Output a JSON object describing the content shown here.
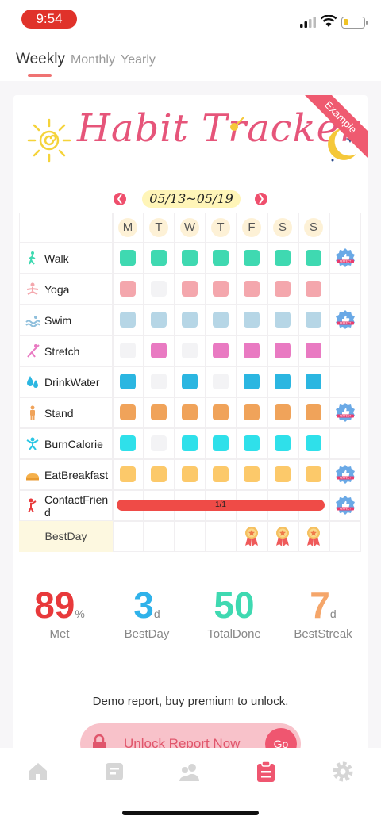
{
  "status_bar": {
    "time": "9:54"
  },
  "tabs": [
    {
      "label": "Weekly",
      "active": true
    },
    {
      "label": "Monthly",
      "active": false
    },
    {
      "label": "Yearly",
      "active": false
    }
  ],
  "card": {
    "title": "Habit Tracker",
    "ribbon": "Example",
    "week_range": "05/13~05/19",
    "days": [
      "M",
      "T",
      "W",
      "T",
      "F",
      "S",
      "S"
    ],
    "habits": [
      {
        "name": "Walk",
        "icon": "walk-icon",
        "color": "#3fd9b1",
        "done": [
          1,
          1,
          1,
          1,
          1,
          1,
          1
        ],
        "perfect": true
      },
      {
        "name": "Yoga",
        "icon": "yoga-icon",
        "color": "#f4a7ad",
        "done": [
          1,
          0,
          1,
          1,
          1,
          1,
          1
        ],
        "perfect": false
      },
      {
        "name": "Swim",
        "icon": "swim-icon",
        "color": "#b6d6e6",
        "done": [
          1,
          1,
          1,
          1,
          1,
          1,
          1
        ],
        "perfect": true
      },
      {
        "name": "Stretch",
        "icon": "stretch-icon",
        "color": "#e97ac2",
        "done": [
          0,
          1,
          0,
          1,
          1,
          1,
          1
        ],
        "perfect": false
      },
      {
        "name": "DrinkWater",
        "icon": "water-drop-icon",
        "color": "#2bb6e1",
        "done": [
          1,
          0,
          1,
          0,
          1,
          1,
          1
        ],
        "perfect": false
      },
      {
        "name": "Stand",
        "icon": "stand-icon",
        "color": "#f0a35a",
        "done": [
          1,
          1,
          1,
          1,
          1,
          1,
          1
        ],
        "perfect": true
      },
      {
        "name": "BurnCalorie",
        "icon": "burn-calorie-icon",
        "color": "#2fe0ea",
        "done": [
          1,
          0,
          1,
          1,
          1,
          1,
          1
        ],
        "perfect": false
      },
      {
        "name": "EatBreakfast",
        "icon": "breakfast-icon",
        "color": "#fcc96a",
        "done": [
          1,
          1,
          1,
          1,
          1,
          1,
          1
        ],
        "perfect": true
      },
      {
        "name": "ContactFriend",
        "icon": "contact-friend-icon",
        "color": "#ef4b47",
        "progress_label": "1/1",
        "perfect": true
      }
    ],
    "badge_text": "PERFECT",
    "bestday_label": "BestDay",
    "bestday_medals": [
      0,
      0,
      0,
      0,
      1,
      1,
      1
    ]
  },
  "stats": [
    {
      "value": "89",
      "unit": "%",
      "label": "Met",
      "color": "#e8393b"
    },
    {
      "value": "3",
      "unit": "d",
      "label": "BestDay",
      "color": "#2fb2ea"
    },
    {
      "value": "50",
      "unit": "",
      "label": "TotalDone",
      "color": "#3fd9b1"
    },
    {
      "value": "7",
      "unit": "d",
      "label": "BestStreak",
      "color": "#f5a66a"
    }
  ],
  "demo_text": "Demo report, buy premium to unlock.",
  "unlock": {
    "label": "Unlock Report Now",
    "go": "Go"
  },
  "bottom_nav": [
    {
      "icon": "home-icon",
      "active": false
    },
    {
      "icon": "notes-icon",
      "active": false
    },
    {
      "icon": "friends-icon",
      "active": false
    },
    {
      "icon": "report-icon",
      "active": true
    },
    {
      "icon": "settings-icon",
      "active": false
    }
  ]
}
